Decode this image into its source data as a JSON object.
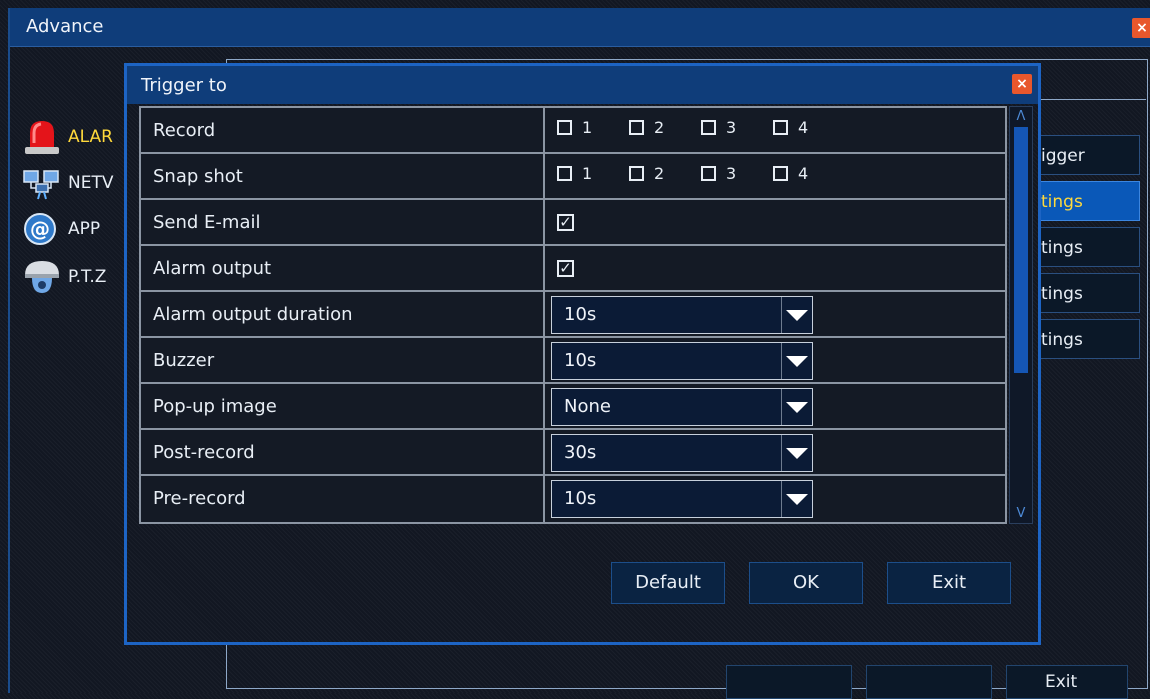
{
  "outer_window": {
    "title": "Advance",
    "close_glyph": "×",
    "sidebar": [
      {
        "label": "ALAR",
        "icon": "alarm-light-icon"
      },
      {
        "label": "NETV",
        "icon": "network-icon"
      },
      {
        "label": "APP",
        "icon": "at-sign-icon"
      },
      {
        "label": "P.T.Z",
        "icon": "dome-camera-icon"
      }
    ],
    "right_buttons": [
      {
        "label": "igger",
        "active": false
      },
      {
        "label": "tings",
        "active": true
      },
      {
        "label": "tings",
        "active": false
      },
      {
        "label": "tings",
        "active": false
      },
      {
        "label": "tings",
        "active": false
      }
    ],
    "exit_label": "Exit"
  },
  "dialog": {
    "title": "Trigger to",
    "close_glyph": "×",
    "rows": {
      "record": {
        "label": "Record",
        "options": [
          "1",
          "2",
          "3",
          "4"
        ]
      },
      "snap_shot": {
        "label": "Snap shot",
        "options": [
          "1",
          "2",
          "3",
          "4"
        ]
      },
      "send_email": {
        "label": "Send E-mail",
        "checked_glyph": "✓"
      },
      "alarm_output": {
        "label": "Alarm output",
        "checked_glyph": "✓"
      },
      "alarm_output_duration": {
        "label": "Alarm output duration",
        "value": "10s"
      },
      "buzzer": {
        "label": "Buzzer",
        "value": "10s"
      },
      "popup_image": {
        "label": "Pop-up image",
        "value": "None"
      },
      "post_record": {
        "label": "Post-record",
        "value": "30s"
      },
      "pre_record": {
        "label": "Pre-record",
        "value": "10s"
      }
    },
    "scroll_up_glyph": "Λ",
    "scroll_down_glyph": "V",
    "buttons": {
      "default": "Default",
      "ok": "OK",
      "exit": "Exit"
    }
  },
  "colors": {
    "title_bar": "#0f3d7a",
    "dialog_border": "#1d64c4",
    "close_button": "#e8572c",
    "active_item_text": "#ffd93b",
    "active_item_bg": "#0a58b8"
  }
}
